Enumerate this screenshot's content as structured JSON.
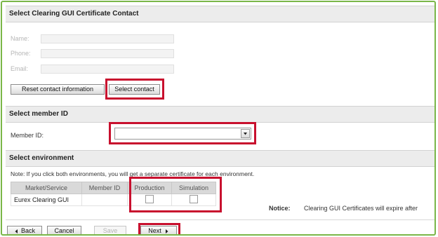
{
  "contact_section": {
    "title": "Select Clearing GUI Certificate Contact",
    "name_label": "Name:",
    "phone_label": "Phone:",
    "email_label": "Email:",
    "reset_button": "Reset contact information",
    "select_button": "Select contact"
  },
  "member_section": {
    "title": "Select member ID",
    "member_label": "Member ID:",
    "member_value": ""
  },
  "environment_section": {
    "title": "Select environment",
    "note": "Note: If you click both environments, you will get a separate certificate for each environment.",
    "columns": [
      "Market/Service",
      "Member ID",
      "Production",
      "Simulation"
    ],
    "row": {
      "market": "Eurex Clearing GUI",
      "member_id": ""
    },
    "notice_label": "Notice:",
    "notice_text": "Clearing GUI Certificates will expire after"
  },
  "nav": {
    "back": "Back",
    "cancel": "Cancel",
    "save": "Save",
    "next": "Next"
  },
  "colors": {
    "frame": "#7ab648",
    "highlight": "#c8102e"
  }
}
